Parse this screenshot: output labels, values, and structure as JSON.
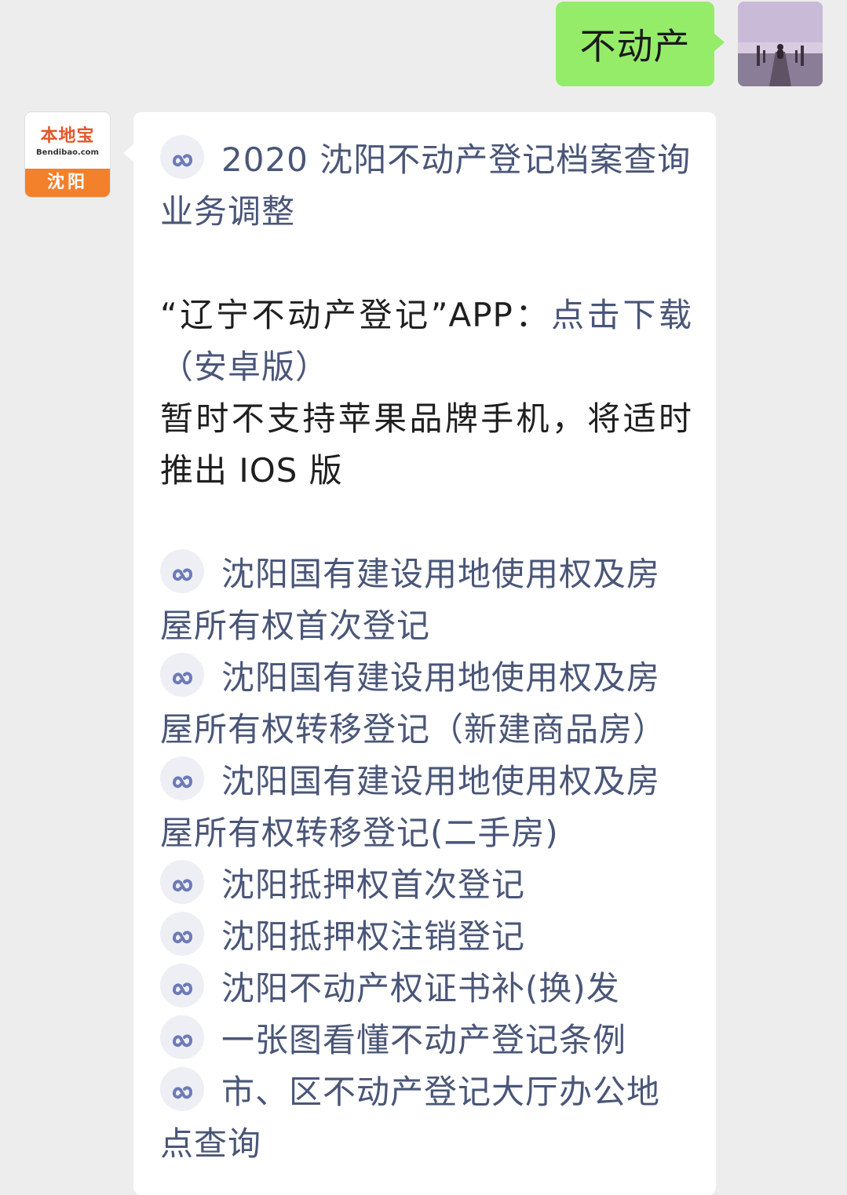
{
  "outgoing": {
    "text": "不动产"
  },
  "bot": {
    "logo_name": "本地宝",
    "logo_domain": "Bendibao.com",
    "logo_city": "沈阳"
  },
  "message": {
    "intro_link": "2020 沈阳不动产登记档案查询业务调整",
    "app_prefix": "“辽宁不动产登记”APP：",
    "app_download": "点击下载（安卓版）",
    "ios_note": "暂时不支持苹果品牌手机，将适时推出 IOS 版",
    "links": [
      "沈阳国有建设用地使用权及房屋所有权首次登记",
      "沈阳国有建设用地使用权及房屋所有权转移登记（新建商品房）",
      "沈阳国有建设用地使用权及房屋所有权转移登记(二手房)",
      "沈阳抵押权首次登记",
      "沈阳抵押权注销登记",
      "沈阳不动产权证书补(换)发",
      "一张图看懂不动产登记条例",
      "市、区不动产登记大厅办公地点查询"
    ]
  },
  "colors": {
    "background": "#ededed",
    "outgoing_bubble": "#95ec69",
    "incoming_bubble": "#ffffff",
    "link_text": "#4a5678",
    "icon_bg": "#eeeff4",
    "icon_fg": "#6d7ab8",
    "logo_orange": "#f3802b"
  },
  "icons": {
    "mini_program": "mini-program-link-icon"
  }
}
